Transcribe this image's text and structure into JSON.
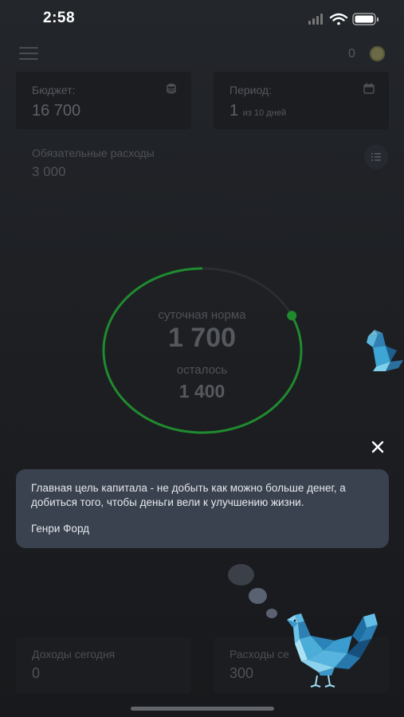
{
  "status_bar": {
    "time": "2:58"
  },
  "top_bar": {
    "coin_count": "0"
  },
  "budget": {
    "label": "Бюджет:",
    "value": "16 700"
  },
  "period": {
    "label": "Период:",
    "day": "1",
    "suffix": "из 10 дней"
  },
  "mandatory": {
    "label": "Обязательные расходы",
    "value": "3 000"
  },
  "daily": {
    "norm_label": "суточная норма",
    "norm_value": "1 700",
    "left_label": "осталось",
    "left_value": "1 400",
    "progress_fraction": 0.82,
    "ring_color": "#1f8a2e"
  },
  "quote": {
    "text": "Главная цель капитала - не добыть как можно больше денег, а добиться того, чтобы деньги вели к улучшению жизни.",
    "author": "Генри Форд"
  },
  "income_today": {
    "label": "Доходы сегодня",
    "value": "0"
  },
  "expenses_today": {
    "label": "Расходы се",
    "value": "300"
  },
  "icons": [
    "menu-icon",
    "coin-icon",
    "database-icon",
    "calendar-icon",
    "list-icon",
    "close-icon",
    "wifi-icon",
    "battery-icon",
    "signal-icon",
    "bird-mascot-icon"
  ]
}
